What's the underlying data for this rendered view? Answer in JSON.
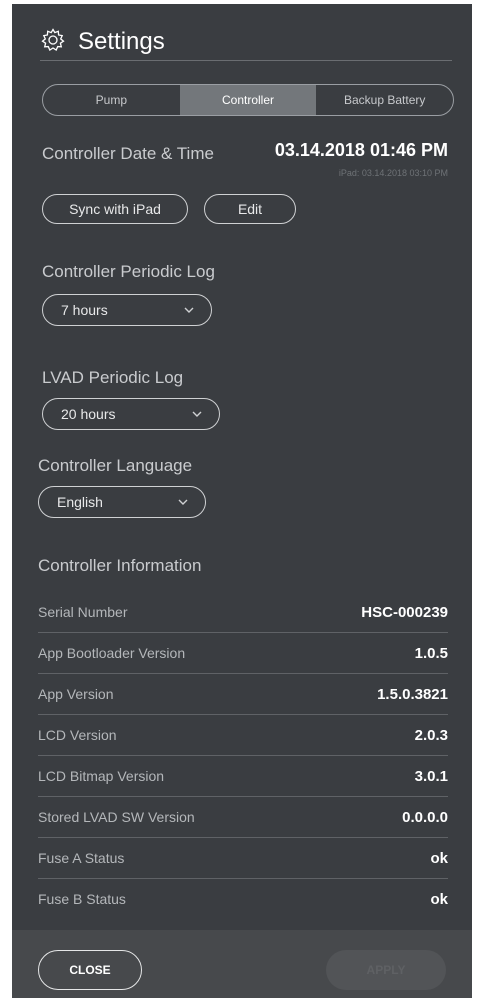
{
  "header": {
    "title": "Settings",
    "icon": "gear-icon"
  },
  "tabs": [
    {
      "label": "Pump",
      "active": false
    },
    {
      "label": "Controller",
      "active": true
    },
    {
      "label": "Backup Battery",
      "active": false
    }
  ],
  "datetime": {
    "label": "Controller Date & Time",
    "value": "03.14.2018 01:46 PM",
    "ipad_value": "iPad: 03.14.2018 03:10 PM",
    "sync_label": "Sync with iPad",
    "edit_label": "Edit"
  },
  "controller_log": {
    "label": "Controller Periodic Log",
    "value": "7 hours"
  },
  "lvad_log": {
    "label": "LVAD Periodic Log",
    "value": "20 hours"
  },
  "language": {
    "label": "Controller Language",
    "value": "English"
  },
  "info": {
    "title": "Controller Information",
    "rows": [
      {
        "key": "Serial Number",
        "value": "HSC-000239"
      },
      {
        "key": "App Bootloader Version",
        "value": "1.0.5"
      },
      {
        "key": "App Version",
        "value": "1.5.0.3821"
      },
      {
        "key": "LCD Version",
        "value": "2.0.3"
      },
      {
        "key": "LCD Bitmap Version",
        "value": "3.0.1"
      },
      {
        "key": "Stored LVAD SW Version",
        "value": "0.0.0.0"
      },
      {
        "key": "Fuse A Status",
        "value": "ok"
      },
      {
        "key": "Fuse B Status",
        "value": "ok"
      }
    ]
  },
  "footer": {
    "close_label": "CLOSE",
    "apply_label": "APPLY"
  },
  "colors": {
    "panel": "#3a3d41",
    "active_tab": "#73777b",
    "footer": "#47494c"
  }
}
